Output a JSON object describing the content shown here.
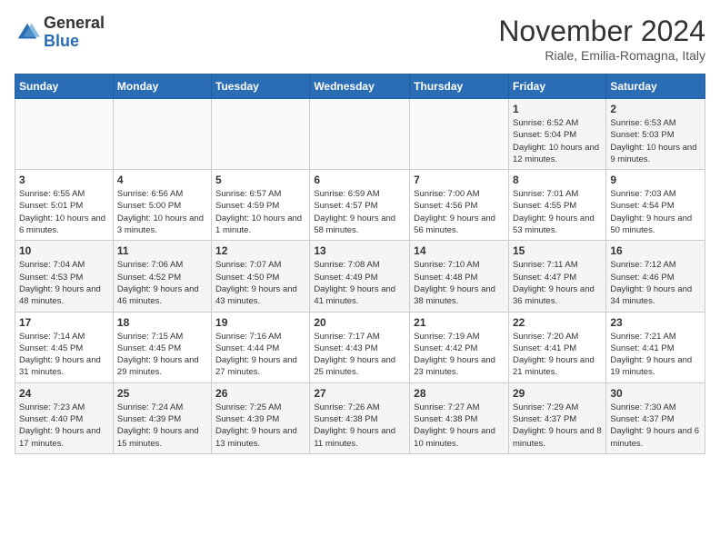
{
  "header": {
    "logo_general": "General",
    "logo_blue": "Blue",
    "month_title": "November 2024",
    "location": "Riale, Emilia-Romagna, Italy"
  },
  "weekdays": [
    "Sunday",
    "Monday",
    "Tuesday",
    "Wednesday",
    "Thursday",
    "Friday",
    "Saturday"
  ],
  "weeks": [
    [
      {
        "day": "",
        "info": ""
      },
      {
        "day": "",
        "info": ""
      },
      {
        "day": "",
        "info": ""
      },
      {
        "day": "",
        "info": ""
      },
      {
        "day": "",
        "info": ""
      },
      {
        "day": "1",
        "info": "Sunrise: 6:52 AM\nSunset: 5:04 PM\nDaylight: 10 hours and 12 minutes."
      },
      {
        "day": "2",
        "info": "Sunrise: 6:53 AM\nSunset: 5:03 PM\nDaylight: 10 hours and 9 minutes."
      }
    ],
    [
      {
        "day": "3",
        "info": "Sunrise: 6:55 AM\nSunset: 5:01 PM\nDaylight: 10 hours and 6 minutes."
      },
      {
        "day": "4",
        "info": "Sunrise: 6:56 AM\nSunset: 5:00 PM\nDaylight: 10 hours and 3 minutes."
      },
      {
        "day": "5",
        "info": "Sunrise: 6:57 AM\nSunset: 4:59 PM\nDaylight: 10 hours and 1 minute."
      },
      {
        "day": "6",
        "info": "Sunrise: 6:59 AM\nSunset: 4:57 PM\nDaylight: 9 hours and 58 minutes."
      },
      {
        "day": "7",
        "info": "Sunrise: 7:00 AM\nSunset: 4:56 PM\nDaylight: 9 hours and 56 minutes."
      },
      {
        "day": "8",
        "info": "Sunrise: 7:01 AM\nSunset: 4:55 PM\nDaylight: 9 hours and 53 minutes."
      },
      {
        "day": "9",
        "info": "Sunrise: 7:03 AM\nSunset: 4:54 PM\nDaylight: 9 hours and 50 minutes."
      }
    ],
    [
      {
        "day": "10",
        "info": "Sunrise: 7:04 AM\nSunset: 4:53 PM\nDaylight: 9 hours and 48 minutes."
      },
      {
        "day": "11",
        "info": "Sunrise: 7:06 AM\nSunset: 4:52 PM\nDaylight: 9 hours and 46 minutes."
      },
      {
        "day": "12",
        "info": "Sunrise: 7:07 AM\nSunset: 4:50 PM\nDaylight: 9 hours and 43 minutes."
      },
      {
        "day": "13",
        "info": "Sunrise: 7:08 AM\nSunset: 4:49 PM\nDaylight: 9 hours and 41 minutes."
      },
      {
        "day": "14",
        "info": "Sunrise: 7:10 AM\nSunset: 4:48 PM\nDaylight: 9 hours and 38 minutes."
      },
      {
        "day": "15",
        "info": "Sunrise: 7:11 AM\nSunset: 4:47 PM\nDaylight: 9 hours and 36 minutes."
      },
      {
        "day": "16",
        "info": "Sunrise: 7:12 AM\nSunset: 4:46 PM\nDaylight: 9 hours and 34 minutes."
      }
    ],
    [
      {
        "day": "17",
        "info": "Sunrise: 7:14 AM\nSunset: 4:45 PM\nDaylight: 9 hours and 31 minutes."
      },
      {
        "day": "18",
        "info": "Sunrise: 7:15 AM\nSunset: 4:45 PM\nDaylight: 9 hours and 29 minutes."
      },
      {
        "day": "19",
        "info": "Sunrise: 7:16 AM\nSunset: 4:44 PM\nDaylight: 9 hours and 27 minutes."
      },
      {
        "day": "20",
        "info": "Sunrise: 7:17 AM\nSunset: 4:43 PM\nDaylight: 9 hours and 25 minutes."
      },
      {
        "day": "21",
        "info": "Sunrise: 7:19 AM\nSunset: 4:42 PM\nDaylight: 9 hours and 23 minutes."
      },
      {
        "day": "22",
        "info": "Sunrise: 7:20 AM\nSunset: 4:41 PM\nDaylight: 9 hours and 21 minutes."
      },
      {
        "day": "23",
        "info": "Sunrise: 7:21 AM\nSunset: 4:41 PM\nDaylight: 9 hours and 19 minutes."
      }
    ],
    [
      {
        "day": "24",
        "info": "Sunrise: 7:23 AM\nSunset: 4:40 PM\nDaylight: 9 hours and 17 minutes."
      },
      {
        "day": "25",
        "info": "Sunrise: 7:24 AM\nSunset: 4:39 PM\nDaylight: 9 hours and 15 minutes."
      },
      {
        "day": "26",
        "info": "Sunrise: 7:25 AM\nSunset: 4:39 PM\nDaylight: 9 hours and 13 minutes."
      },
      {
        "day": "27",
        "info": "Sunrise: 7:26 AM\nSunset: 4:38 PM\nDaylight: 9 hours and 11 minutes."
      },
      {
        "day": "28",
        "info": "Sunrise: 7:27 AM\nSunset: 4:38 PM\nDaylight: 9 hours and 10 minutes."
      },
      {
        "day": "29",
        "info": "Sunrise: 7:29 AM\nSunset: 4:37 PM\nDaylight: 9 hours and 8 minutes."
      },
      {
        "day": "30",
        "info": "Sunrise: 7:30 AM\nSunset: 4:37 PM\nDaylight: 9 hours and 6 minutes."
      }
    ]
  ]
}
